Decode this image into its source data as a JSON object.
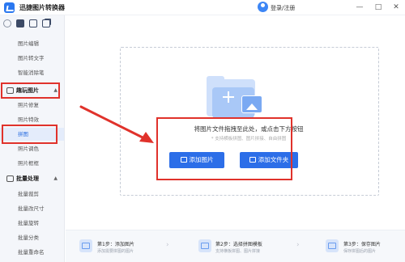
{
  "app": {
    "title": "迅捷图片转换器",
    "login_label": "登录/注册",
    "window_controls": [
      "—",
      "□",
      "✕"
    ]
  },
  "sidebar": {
    "tool_icons": [
      "settings-icon",
      "folder-icon",
      "image-icon",
      "copy-icon"
    ],
    "items_top": [
      "图片编辑",
      "图片转文字",
      "智能消除笔"
    ],
    "section_fun": {
      "label": "趣玩图片",
      "caret": "▲"
    },
    "items_fun": [
      "照片修复",
      "照片特效",
      "拼图",
      "照片调色",
      "照片框框"
    ],
    "section_batch": {
      "label": "批量处理",
      "caret": "▲"
    },
    "items_batch": [
      "批量裁剪",
      "批量改尺寸",
      "批量旋转",
      "批量分类",
      "批量重命名"
    ]
  },
  "dropzone": {
    "main_text": "将图片文件拖拽至此处，或点击下方按钮",
    "sub_text": "* 支持横板拼图、图片拼接、自由拼图",
    "add_image_button": "添加图片",
    "add_folder_button": "添加文件夹"
  },
  "steps": [
    {
      "title": "第1步：添加图片",
      "desc": "添加需要拼图的图片"
    },
    {
      "title": "第2步：选择拼图模板",
      "desc": "支持横板拼图、图片拼接"
    },
    {
      "title": "第3步：保存图片",
      "desc": "保存拼图后的图片"
    }
  ],
  "colors": {
    "accent": "#2c6ee8",
    "highlight": "#e0322b"
  }
}
